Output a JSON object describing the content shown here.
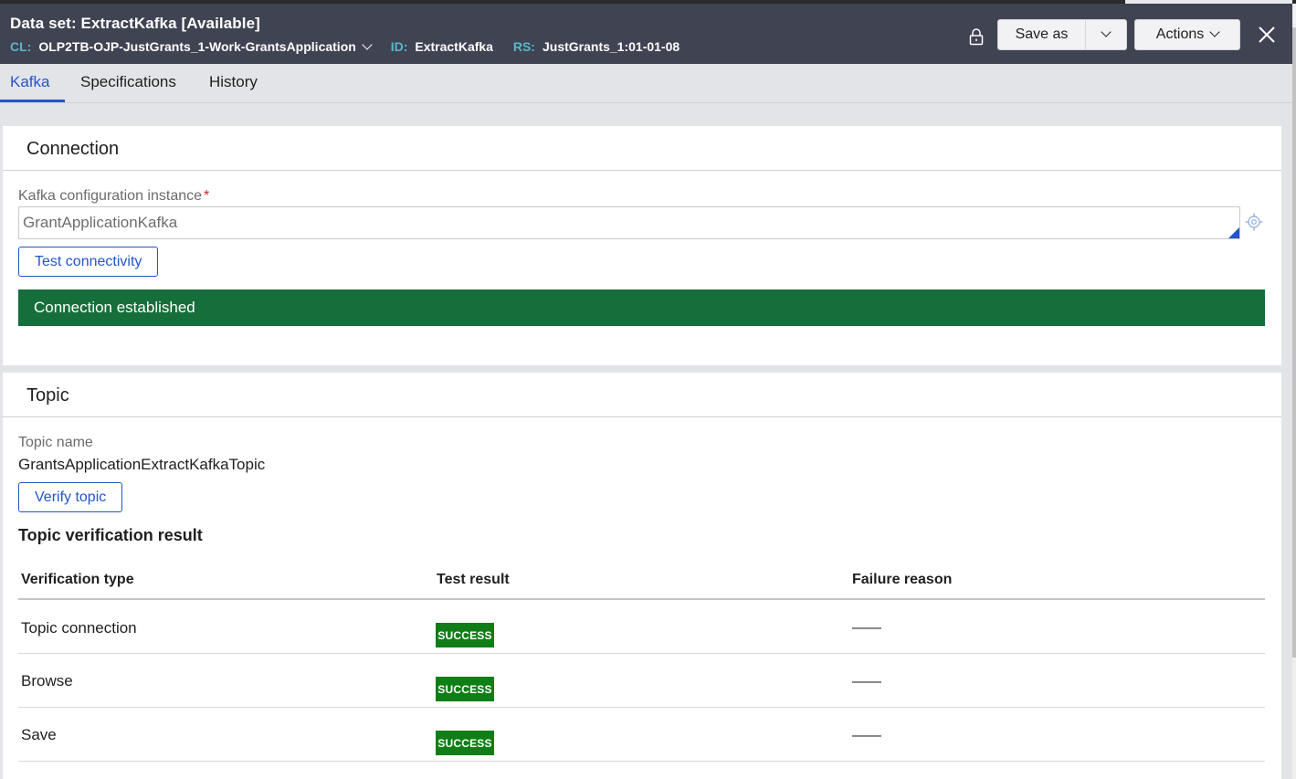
{
  "header": {
    "title": "Data set: ExtractKafka [Available]",
    "cl_label": "CL:",
    "cl_value": "OLP2TB-OJP-JustGrants_1-Work-GrantsApplication",
    "id_label": "ID:",
    "id_value": "ExtractKafka",
    "rs_label": "RS:",
    "rs_value": "JustGrants_1:01-01-08",
    "save_as_label": "Save as",
    "actions_label": "Actions"
  },
  "tabs": [
    {
      "label": "Kafka",
      "active": true
    },
    {
      "label": "Specifications",
      "active": false
    },
    {
      "label": "History",
      "active": false
    }
  ],
  "connection": {
    "title": "Connection",
    "config_label": "Kafka configuration instance",
    "required_marker": "*",
    "config_value": "GrantApplicationKafka",
    "test_button": "Test connectivity",
    "status_message": "Connection established"
  },
  "topic": {
    "title": "Topic",
    "name_label": "Topic name",
    "name_value": "GrantsApplicationExtractKafkaTopic",
    "verify_button": "Verify topic",
    "result_heading": "Topic verification result",
    "columns": [
      "Verification type",
      "Test result",
      "Failure reason"
    ],
    "rows": [
      {
        "type": "Topic connection",
        "result": "SUCCESS",
        "reason": "——"
      },
      {
        "type": "Browse",
        "result": "SUCCESS",
        "reason": "——"
      },
      {
        "type": "Save",
        "result": "SUCCESS",
        "reason": "——"
      }
    ]
  },
  "colors": {
    "header_bg": "#3f4352",
    "accent": "#2355c9",
    "success_banner": "#166f3a",
    "success_badge": "#0f7e16"
  }
}
